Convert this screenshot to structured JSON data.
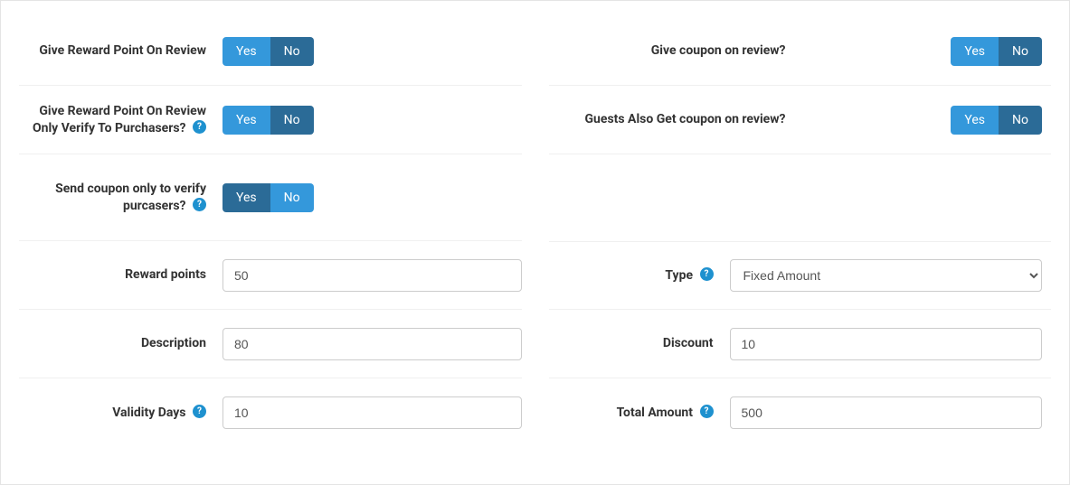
{
  "toggles": {
    "yes": "Yes",
    "no": "No"
  },
  "left": {
    "reward_on_review_label": "Give Reward Point On Review",
    "reward_on_review_selected": "no",
    "reward_verify_label": "Give Reward Point On Review Only Verify To Purchasers?",
    "reward_verify_selected": "no",
    "coupon_verify_label": "Send coupon only to verify purcasers?",
    "coupon_verify_selected": "yes",
    "reward_points_label": "Reward points",
    "reward_points_value": "50",
    "description_label": "Description",
    "description_value": "80",
    "validity_label": "Validity Days",
    "validity_value": "10"
  },
  "right": {
    "coupon_on_review_label": "Give coupon on review?",
    "coupon_on_review_selected": "no",
    "guests_coupon_label": "Guests Also Get coupon on review?",
    "guests_coupon_selected": "no",
    "type_label": "Type",
    "type_value": "Fixed Amount",
    "discount_label": "Discount",
    "discount_value": "10",
    "total_amount_label": "Total Amount",
    "total_amount_value": "500"
  },
  "help_glyph": "?"
}
